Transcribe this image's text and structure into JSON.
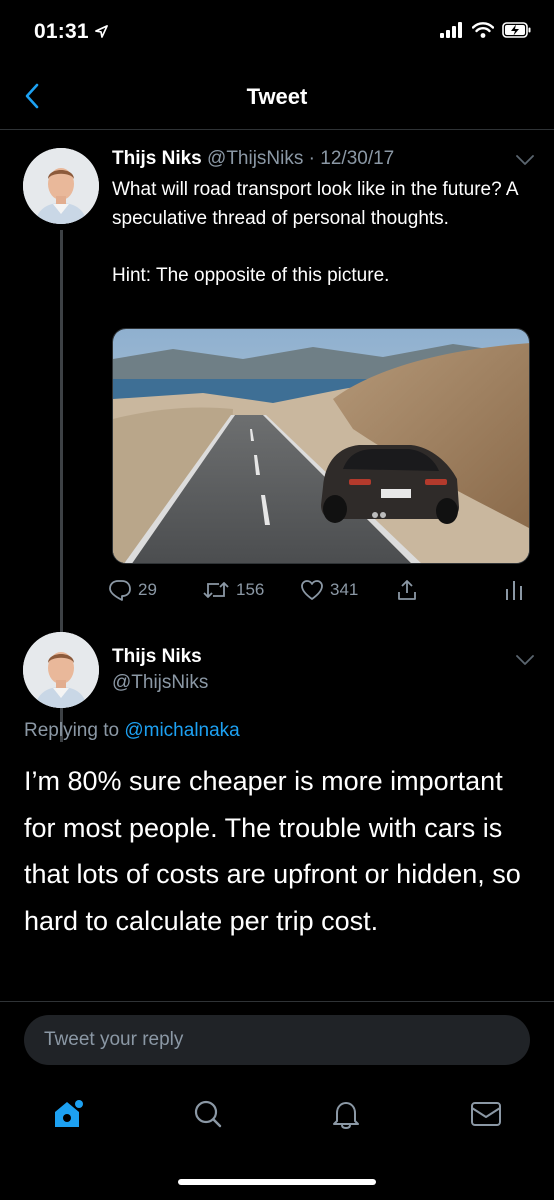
{
  "status_bar": {
    "time": "01:31",
    "icons": [
      "location-arrow-icon",
      "signal-icon",
      "wifi-icon",
      "battery-charging-icon"
    ]
  },
  "nav": {
    "title": "Tweet",
    "back_icon": "chevron-left-icon"
  },
  "parent_tweet": {
    "author_name": "Thijs Niks",
    "author_handle": "@ThijsNiks",
    "separator": "·",
    "date": "12/30/17",
    "text": "What will road transport look like in the future? A speculative thread of personal thoughts.\n\nHint: The opposite of this picture.",
    "image_description_icon": "car-photo",
    "actions": {
      "replies": "29",
      "retweets": "156",
      "likes": "341"
    }
  },
  "reply_tweet": {
    "author_name": "Thijs Niks",
    "author_handle": "@ThijsNiks",
    "replying_to_label": "Replying to ",
    "replying_to_mention": "@michalnaka",
    "text": "I’m 80% sure cheaper is more important for most people. The trouble with cars is that lots of costs are upfront or hidden, so hard to calculate per trip cost."
  },
  "compose": {
    "placeholder": "Tweet your reply"
  },
  "tab_bar": {
    "tabs": [
      "home-icon",
      "search-icon",
      "notifications-icon",
      "messages-icon"
    ]
  },
  "colors": {
    "background": "#000000",
    "accent": "#1da1f2",
    "secondary_text": "#8b98a5",
    "divider": "#2f3336"
  }
}
